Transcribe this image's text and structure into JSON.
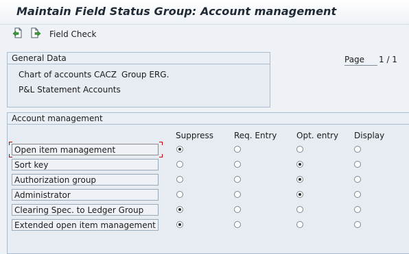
{
  "window": {
    "title": "Maintain Field Status Group: Account management"
  },
  "toolbar": {
    "prev_icon": "previous-page-icon",
    "next_icon": "next-page-icon",
    "field_check_label": "Field Check"
  },
  "general": {
    "header": "General Data",
    "chart_label": "Chart of accounts CACZ",
    "group_label": "Group ERG.",
    "description": "P&L Statement Accounts"
  },
  "paging": {
    "page_label": "Page",
    "page_value": "1 / 1"
  },
  "account_management": {
    "header": "Account management",
    "columns": [
      "Suppress",
      "Req. Entry",
      "Opt. entry",
      "Display"
    ],
    "rows": [
      {
        "label": "Open item management",
        "selected": 0
      },
      {
        "label": "Sort key",
        "selected": 2
      },
      {
        "label": "Authorization group",
        "selected": 2
      },
      {
        "label": "Administrator",
        "selected": 2
      },
      {
        "label": "Clearing Spec. to Ledger Group",
        "selected": 0
      },
      {
        "label": "Extended open item management",
        "selected": 0
      }
    ]
  },
  "colors": {
    "background": "#eef2f6",
    "border": "#a9bccf",
    "focus_corner": "#c00000"
  }
}
